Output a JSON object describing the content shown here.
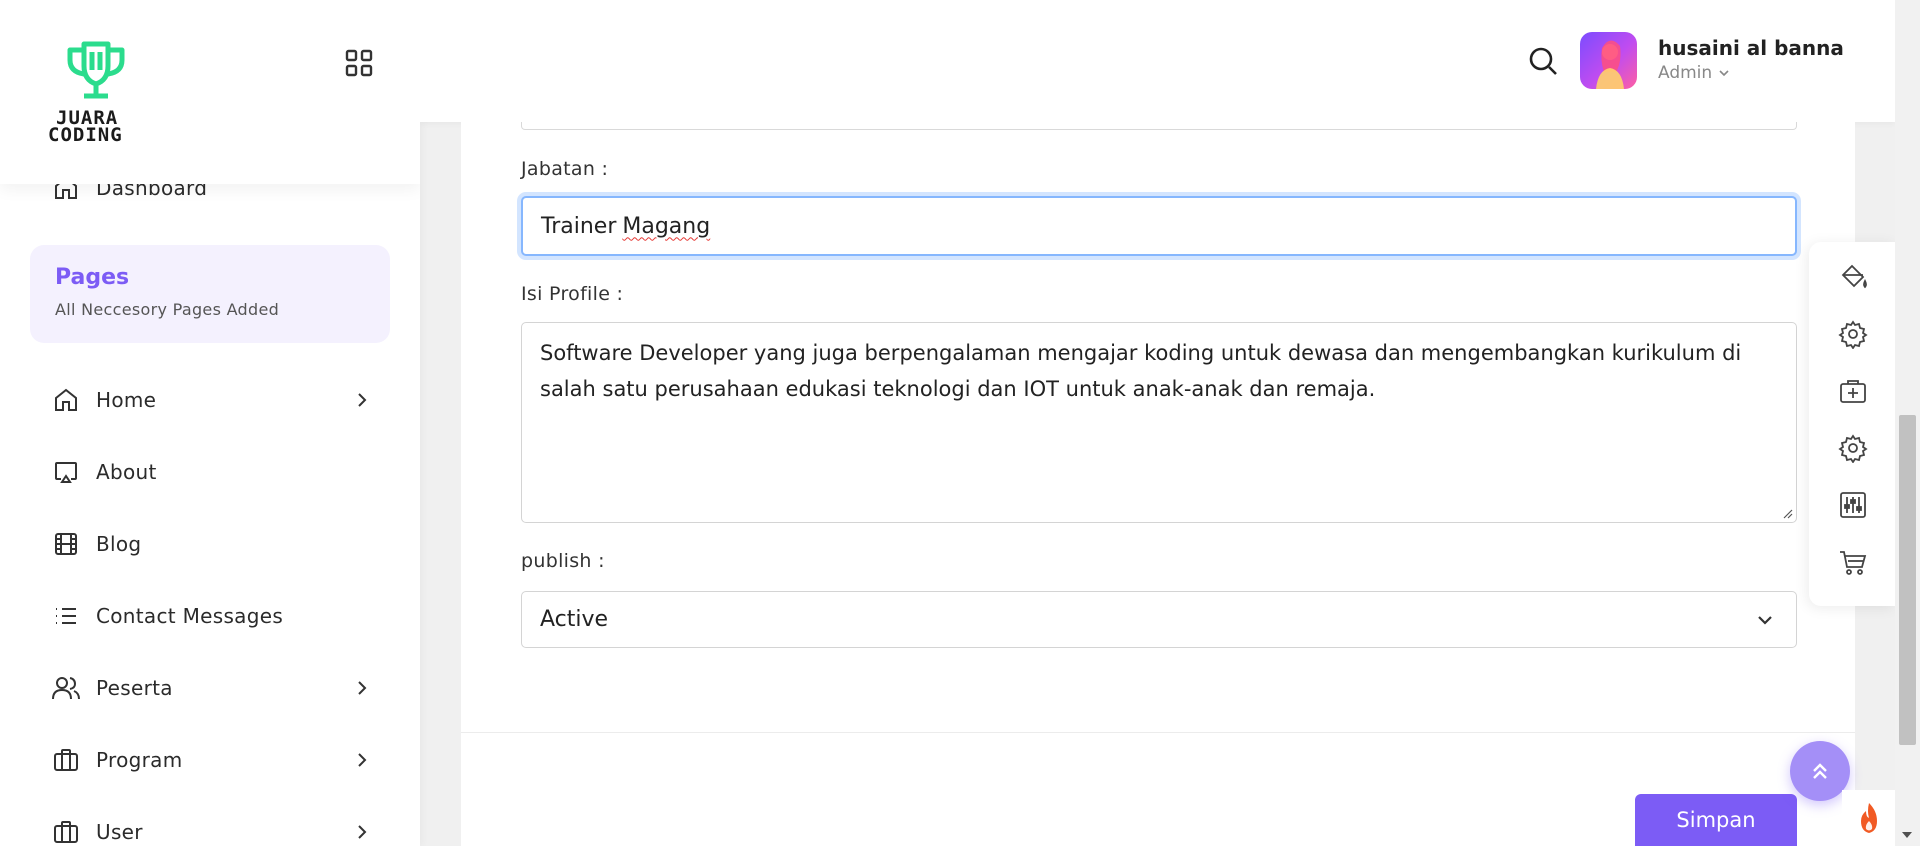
{
  "brand": {
    "logo_text_line1": "JUARA",
    "logo_text_line2": "CODING",
    "logo_color": "#2bdc8d"
  },
  "sidebar": {
    "dashboard": {
      "label": "Dashboard",
      "icon": "home-icon"
    },
    "pages_card": {
      "title": "Pages",
      "subtitle": "All Neccesory Pages Added"
    },
    "items": [
      {
        "label": "Home",
        "icon": "home-icon",
        "has_chevron": true
      },
      {
        "label": "About",
        "icon": "cast-icon",
        "has_chevron": false
      },
      {
        "label": "Blog",
        "icon": "film-icon",
        "has_chevron": false
      },
      {
        "label": "Contact Messages",
        "icon": "list-icon",
        "has_chevron": false
      },
      {
        "label": "Peserta",
        "icon": "users-icon",
        "has_chevron": true
      },
      {
        "label": "Program",
        "icon": "briefcase-icon",
        "has_chevron": true
      },
      {
        "label": "User",
        "icon": "briefcase-icon",
        "has_chevron": true
      }
    ]
  },
  "header": {
    "user": {
      "name": "husaini al banna",
      "role": "Admin"
    }
  },
  "form": {
    "jabatan": {
      "label": "Jabatan :",
      "value_word1": "Trainer",
      "value_word2": "Magang"
    },
    "isi_profile": {
      "label": "Isi Profile :",
      "value": "Software Developer yang juga berpengalaman mengajar koding untuk dewasa dan mengembangkan kurikulum di salah satu perusahaan edukasi teknologi dan IOT untuk anak-anak dan remaja."
    },
    "publish": {
      "label": "publish :",
      "selected": "Active"
    },
    "save_label": "Simpan"
  },
  "floating_toolbar": [
    "paint-bucket-icon",
    "gear-icon",
    "medical-kit-icon",
    "gear-icon",
    "sliders-icon",
    "cart-icon"
  ],
  "colors": {
    "accent": "#7c5cf5",
    "accent_light": "#f4f1fe",
    "focus_border": "#86b7fe",
    "flame": "#f15a24"
  }
}
